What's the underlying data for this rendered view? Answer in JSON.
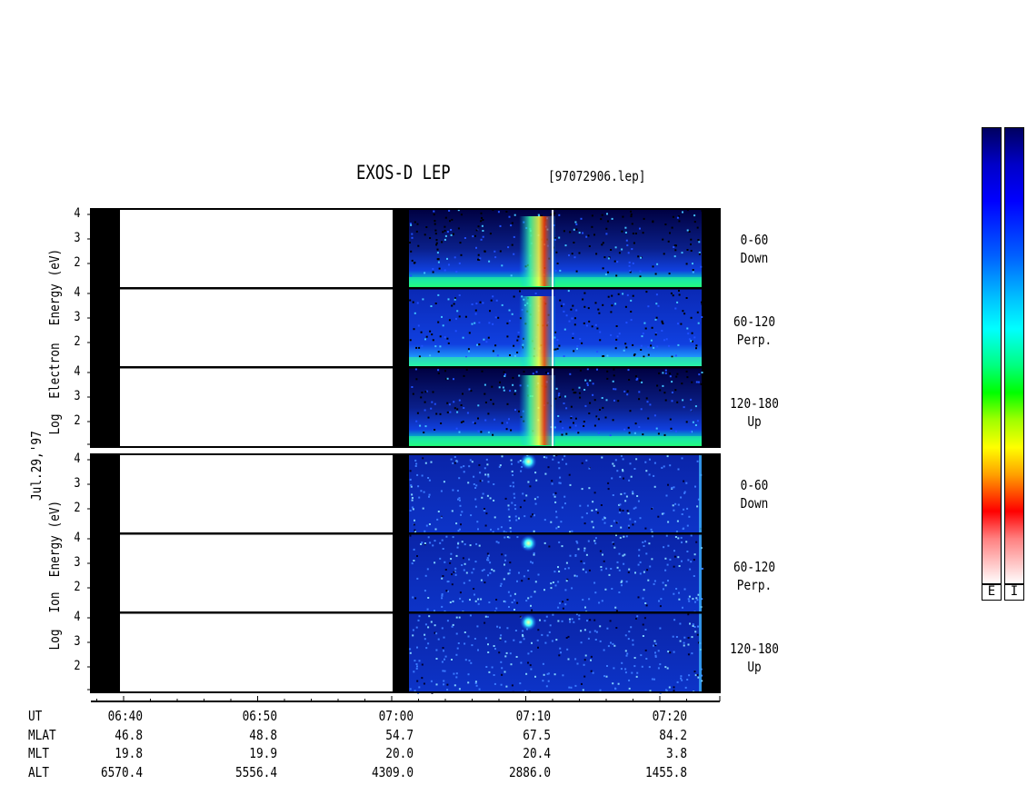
{
  "title": "EXOS-D LEP",
  "filename": "[97072906.lep]",
  "date_label": "Jul.29,'97",
  "electron_ylabel": [
    "Log",
    "Electron",
    "Energy (eV)"
  ],
  "ion_ylabel": [
    "Log",
    "Ion",
    "Energy (eV)"
  ],
  "pitch_labels": [
    {
      "range": "0-60",
      "dir": "Down"
    },
    {
      "range": "60-120",
      "dir": "Perp."
    },
    {
      "range": "120-180",
      "dir": "Up"
    },
    {
      "range": "0-60",
      "dir": "Down"
    },
    {
      "range": "60-120",
      "dir": "Perp."
    },
    {
      "range": "120-180",
      "dir": "Up"
    }
  ],
  "y_ticks": [
    "4",
    "3",
    "2"
  ],
  "y_ticks_bottom": [
    "3",
    "2"
  ],
  "colorbar_labels": [
    "E",
    "I"
  ],
  "orbit": {
    "row_labels": [
      "UT",
      "MLAT",
      "MLT",
      "ALT"
    ],
    "columns": [
      {
        "UT": "06:40",
        "MLAT": "46.8",
        "MLT": "19.8",
        "ALT": "6570.4"
      },
      {
        "UT": "06:50",
        "MLAT": "48.8",
        "MLT": "19.9",
        "ALT": "5556.4"
      },
      {
        "UT": "07:00",
        "MLAT": "54.7",
        "MLT": "20.0",
        "ALT": "4309.0"
      },
      {
        "UT": "07:10",
        "MLAT": "67.5",
        "MLT": "20.4",
        "ALT": "2886.0"
      },
      {
        "UT": "07:20",
        "MLAT": "84.2",
        "MLT": "3.8",
        "ALT": "1455.8"
      }
    ]
  },
  "chart_data": {
    "type": "heatmap",
    "title": "EXOS-D LEP",
    "x_axis": {
      "label": "UT",
      "ticks": [
        "06:40",
        "06:50",
        "07:00",
        "07:10",
        "07:20"
      ]
    },
    "y_axis": {
      "label": "Log Energy (eV)",
      "range": [
        1,
        4.1
      ],
      "ticks": [
        2,
        3,
        4
      ]
    },
    "data_coverage_ut": [
      "07:00",
      "07:24"
    ],
    "panels": [
      {
        "species": "Electron",
        "pitch_angle": "0-60",
        "direction": "Down"
      },
      {
        "species": "Electron",
        "pitch_angle": "60-120",
        "direction": "Perp."
      },
      {
        "species": "Electron",
        "pitch_angle": "120-180",
        "direction": "Up"
      },
      {
        "species": "Ion",
        "pitch_angle": "0-60",
        "direction": "Down"
      },
      {
        "species": "Ion",
        "pitch_angle": "60-120",
        "direction": "Perp."
      },
      {
        "species": "Ion",
        "pitch_angle": "120-180",
        "direction": "Up"
      }
    ],
    "colorbars": [
      "E",
      "I"
    ]
  }
}
